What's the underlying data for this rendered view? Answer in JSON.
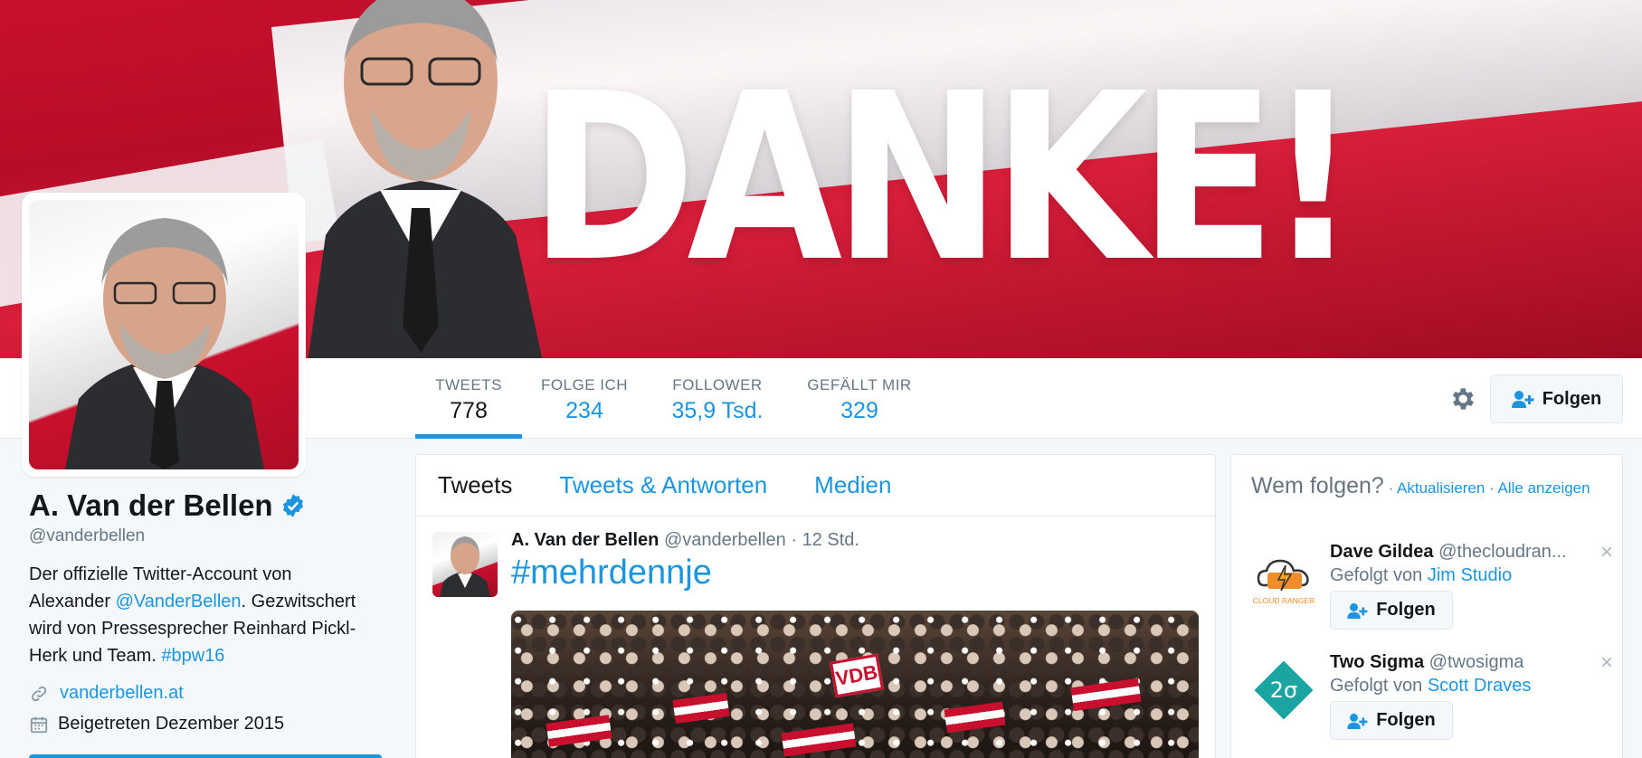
{
  "banner": {
    "headline": "DANKE!"
  },
  "profile": {
    "name": "A. Van der Bellen",
    "handle": "@vanderbellen",
    "bio_part1": "Der offizielle Twitter-Account von Alexander ",
    "bio_mention": "@VanderBellen",
    "bio_part2": ". Gezwitschert wird von Pressesprecher Reinhard Pickl-Herk und Team. ",
    "bio_hashtag": "#bpw16",
    "website": "vanderbellen.at",
    "joined": "Beigetreten Dezember 2015"
  },
  "stats": [
    {
      "label": "TWEETS",
      "value": "778"
    },
    {
      "label": "FOLGE ICH",
      "value": "234"
    },
    {
      "label": "FOLLOWER",
      "value": "35,9 Tsd."
    },
    {
      "label": "GEFÄLLT MIR",
      "value": "329"
    }
  ],
  "actions": {
    "follow_label": "Folgen"
  },
  "timeline": {
    "tabs": [
      "Tweets",
      "Tweets & Antworten",
      "Medien"
    ],
    "tweet": {
      "name": "A. Van der Bellen",
      "handle": "@vanderbellen",
      "time": " · 12 Std.",
      "text": "#mehrdennje",
      "sign": "VDB"
    }
  },
  "who_to_follow": {
    "title": "Wem folgen?",
    "sep1": " · ",
    "refresh": "Aktualisieren",
    "sep2": " · ",
    "view_all": "Alle anzeigen",
    "items": [
      {
        "name": "Dave Gildea",
        "handle": "@thecloudran...",
        "followed_by_prefix": "Gefolgt von ",
        "followed_by": "Jim Studio",
        "button": "Folgen",
        "close": "×",
        "logo_text": "CLOUD RANGER"
      },
      {
        "name": "Two Sigma",
        "handle": "@twosigma",
        "followed_by_prefix": "Gefolgt von ",
        "followed_by": "Scott Draves",
        "button": "Folgen",
        "close": "×",
        "logo_text": "2σ"
      }
    ]
  },
  "colors": {
    "accent": "#1b95e0",
    "banner_red": "#c8102e",
    "text": "#14171a",
    "muted": "#657786"
  }
}
